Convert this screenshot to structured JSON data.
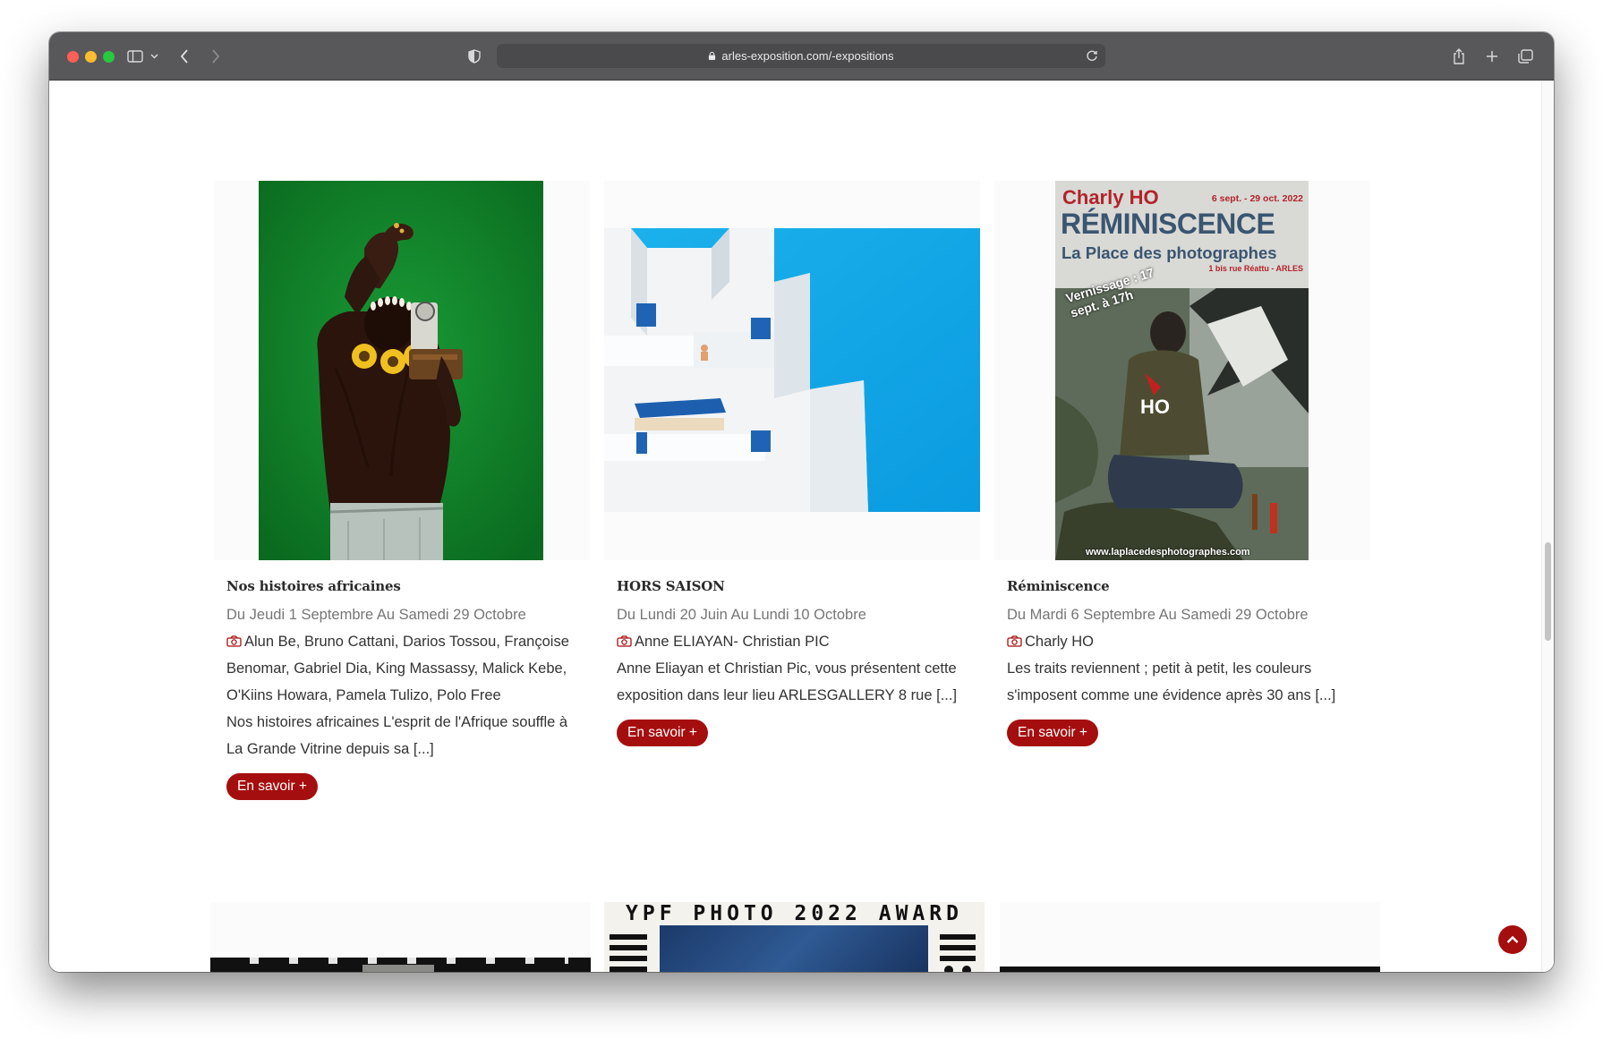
{
  "browser": {
    "url": "arles-exposition.com/-expositions"
  },
  "colors": {
    "accent": "#a50e0e",
    "titlebar": "#58585b"
  },
  "cards": [
    {
      "title": "Nos histoires africaines",
      "dates": "Du Jeudi 1 Septembre Au Samedi 29 Octobre",
      "artists": "Alun Be, Bruno Cattani, Darios Tossou, Françoise Benomar, Gabriel Dia, King Massassy, Malick Kebe, O'Kiins Howara, Pamela Tulizo, Polo Free",
      "description": "Nos histoires africaines L'esprit de l'Afrique souffle à La Grande Vitrine depuis sa [...]",
      "button": "En savoir +"
    },
    {
      "title": "HORS SAISON",
      "dates": "Du Lundi 20 Juin Au Lundi 10 Octobre",
      "artists": "Anne ELIAYAN- Christian PIC",
      "description": "Anne Eliayan et Christian Pic, vous présentent cette exposition dans leur lieu ARLESGALLERY 8 rue [...]",
      "button": "En savoir +"
    },
    {
      "title": "Réminiscence",
      "dates": "Du Mardi 6 Septembre Au Samedi 29 Octobre",
      "artists": "Charly HO",
      "description": "Les traits reviennent ; petit à petit, les couleurs s'imposent comme une évidence après 30 ans [...]",
      "button": "En savoir +"
    }
  ],
  "poster": {
    "artist": "Charly HO",
    "dates": "6 sept. - 29 oct. 2022",
    "title": "RÉMINISCENCE",
    "venue": "La Place des photographes",
    "address": "1 bis rue Réattu - ARLES",
    "vernissage": "Vernissage : 17 sept. à 17h",
    "site": "www.laplacedesphotographes.com"
  },
  "ypf_poster": {
    "title": "YPF PHOTO 2022 AWARD"
  },
  "icons": {
    "camera": "camera-icon",
    "back_to_top": "chevron-up-icon"
  }
}
